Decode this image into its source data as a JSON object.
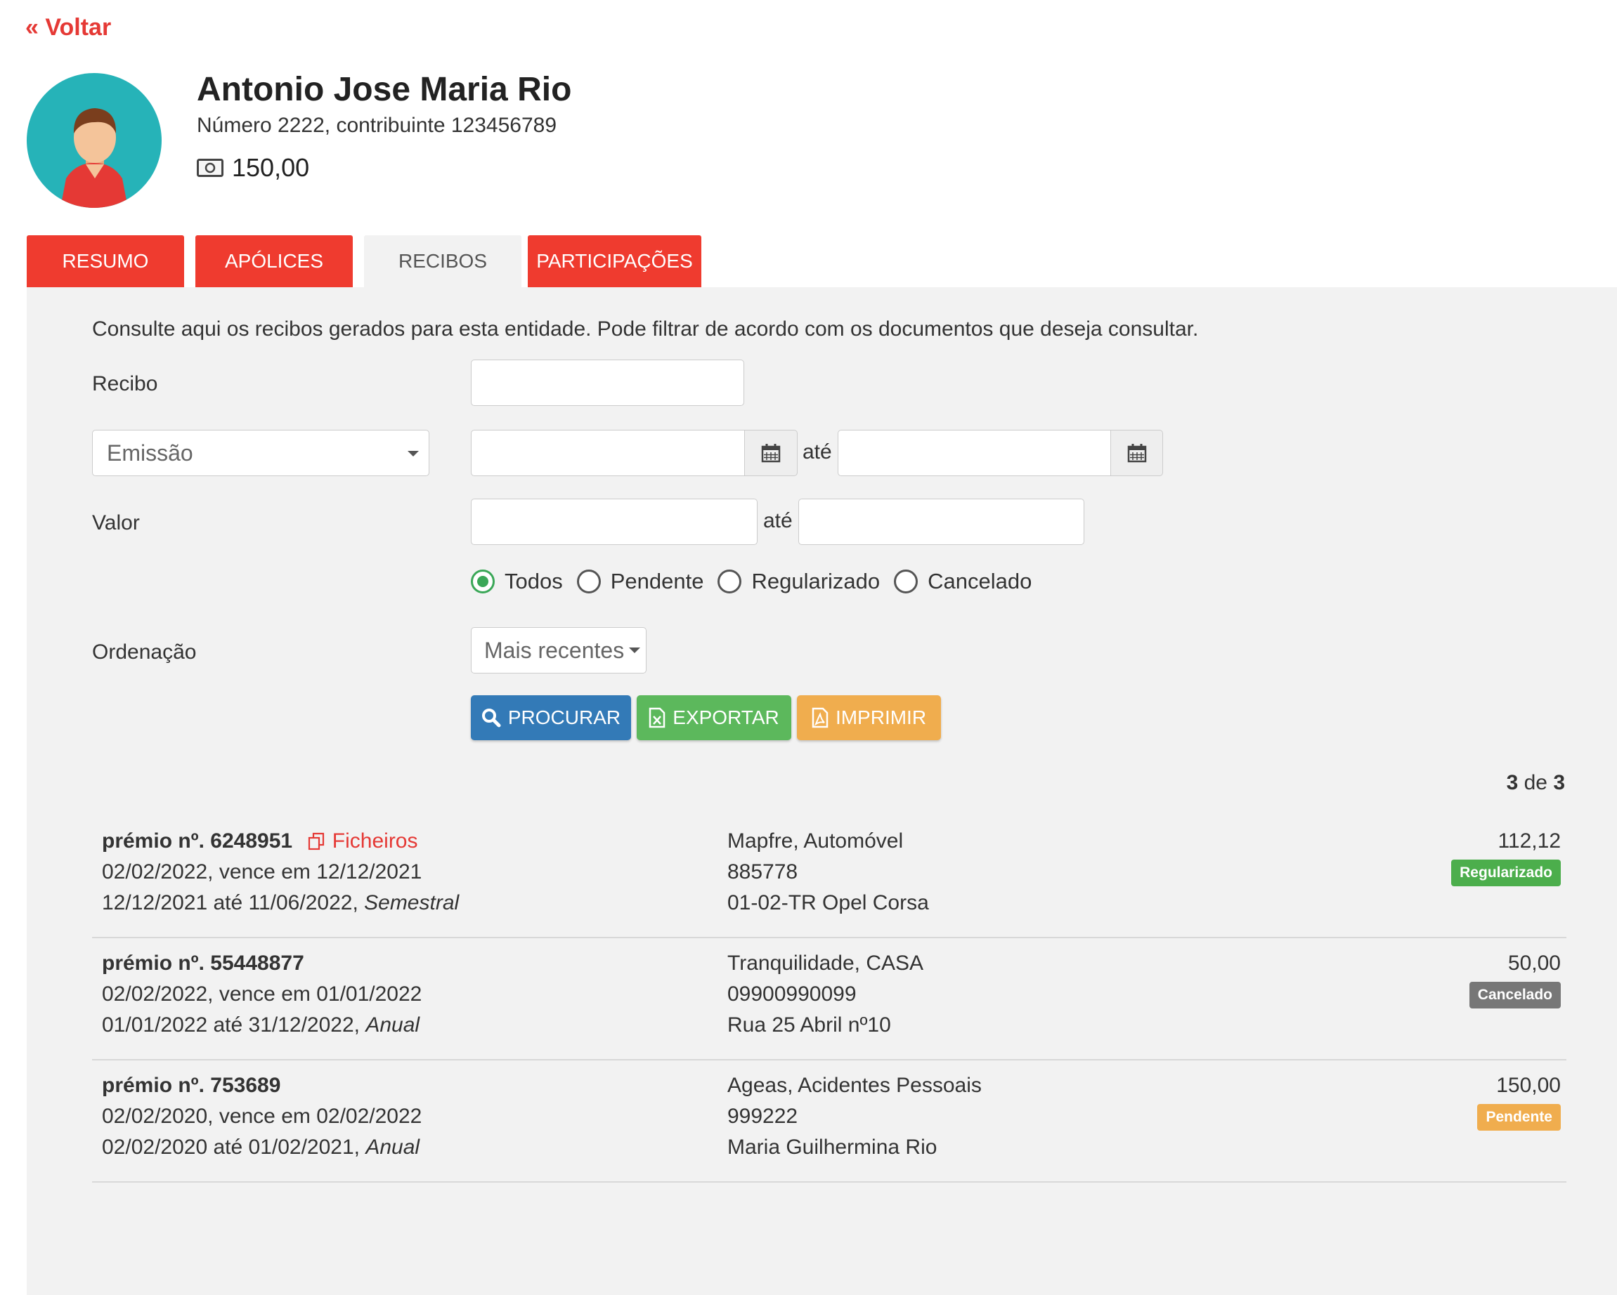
{
  "nav": {
    "back_label": "« Voltar"
  },
  "profile": {
    "name": "Antonio Jose Maria Rio",
    "details": "Número 2222, contribuinte 123456789",
    "balance": "150,00"
  },
  "tabs": [
    {
      "label": "RESUMO",
      "active": false
    },
    {
      "label": "APÓLICES",
      "active": false
    },
    {
      "label": "RECIBOS",
      "active": true
    },
    {
      "label": "PARTICIPAÇÕES",
      "active": false
    }
  ],
  "filters": {
    "intro": "Consulte aqui os recibos gerados para esta entidade. Pode filtrar de acordo com os documentos que deseja consultar.",
    "recibo_label": "Recibo",
    "recibo_value": "",
    "date_type_selected": "Emissão",
    "date_from": "",
    "date_to": "",
    "range_word": "até",
    "valor_label": "Valor",
    "valor_from": "",
    "valor_to": "",
    "status_options": [
      {
        "label": "Todos",
        "checked": true
      },
      {
        "label": "Pendente",
        "checked": false
      },
      {
        "label": "Regularizado",
        "checked": false
      },
      {
        "label": "Cancelado",
        "checked": false
      }
    ],
    "ordenacao_label": "Ordenação",
    "ordenacao_selected": "Mais recentes"
  },
  "actions": {
    "search_label": "PROCURAR",
    "export_label": "EXPORTAR",
    "print_label": "IMPRIMIR"
  },
  "results": {
    "shown": "3",
    "of_word": "de",
    "total": "3",
    "items": [
      {
        "premio_label": "prémio nº. 6248951",
        "files_label": "Ficheiros",
        "line2": "02/02/2022, vence em 12/12/2021",
        "period": "12/12/2021 até 11/06/2022, ",
        "frequency": "Semestral",
        "insurer": "Mapfre, Automóvel",
        "policy": "885778",
        "object": "01-02-TR Opel Corsa",
        "amount": "112,12",
        "status": "Regularizado",
        "status_color": "#4cae4c"
      },
      {
        "premio_label": "prémio nº. 55448877",
        "files_label": "",
        "line2": "02/02/2022, vence em 01/01/2022",
        "period": "01/01/2022 até 31/12/2022, ",
        "frequency": "Anual",
        "insurer": "Tranquilidade, CASA",
        "policy": "09900990099",
        "object": "Rua 25 Abril nº10",
        "amount": "50,00",
        "status": "Cancelado",
        "status_color": "#777777"
      },
      {
        "premio_label": "prémio nº. 753689",
        "files_label": "",
        "line2": "02/02/2020, vence em 02/02/2022",
        "period": "02/02/2020 até 01/02/2021, ",
        "frequency": "Anual",
        "insurer": "Ageas, Acidentes Pessoais",
        "policy": "999222",
        "object": "Maria Guilhermina Rio",
        "amount": "150,00",
        "status": "Pendente",
        "status_color": "#f0ad4e"
      }
    ]
  },
  "colors": {
    "tab_red": "#ef3b2f",
    "search_blue": "#337ab7",
    "export_green": "#5cb85c",
    "print_orange": "#f0ad4e"
  }
}
